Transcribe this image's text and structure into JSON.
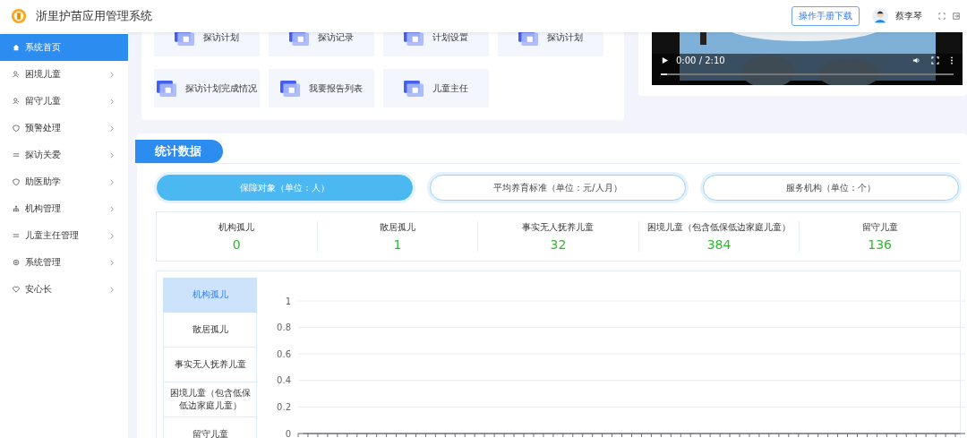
{
  "header": {
    "title": "浙里护苗应用管理系统",
    "manual_button": "操作手册下载",
    "user_name": "蔡李琴"
  },
  "sidebar": {
    "items": [
      {
        "label": "系统首页",
        "selected": true,
        "has_children": false
      },
      {
        "label": "困境儿童",
        "selected": false,
        "has_children": true
      },
      {
        "label": "留守儿童",
        "selected": false,
        "has_children": true
      },
      {
        "label": "预警处理",
        "selected": false,
        "has_children": true
      },
      {
        "label": "探访关爱",
        "selected": false,
        "has_children": true
      },
      {
        "label": "助医助学",
        "selected": false,
        "has_children": true
      },
      {
        "label": "机构管理",
        "selected": false,
        "has_children": true
      },
      {
        "label": "儿童主任管理",
        "selected": false,
        "has_children": true
      },
      {
        "label": "系统管理",
        "selected": false,
        "has_children": true
      },
      {
        "label": "安心长",
        "selected": false,
        "has_children": true
      }
    ]
  },
  "shortcuts": [
    {
      "label": "探访计划"
    },
    {
      "label": "探访记录"
    },
    {
      "label": "计划设置"
    },
    {
      "label": "探访计划"
    },
    {
      "label": "探访计划完成情况"
    },
    {
      "label": "我要报告列表"
    },
    {
      "label": "儿童主任"
    }
  ],
  "video": {
    "time": "0:00 / 2:10",
    "level": 0.02
  },
  "statistics": {
    "title": "统计数据",
    "tabs": [
      {
        "label": "保障对象（单位：人）",
        "selected": true
      },
      {
        "label": "平均养育标准（单位：元/人月）",
        "selected": false
      },
      {
        "label": "服务机构（单位：个）",
        "selected": false
      }
    ],
    "counts": [
      {
        "label": "机构孤儿",
        "value": "0"
      },
      {
        "label": "散居孤儿",
        "value": "1"
      },
      {
        "label": "事实无人抚养儿童",
        "value": "32"
      },
      {
        "label": "困境儿童（包含低保低边家庭儿童）",
        "value": "384"
      },
      {
        "label": "留守儿童",
        "value": "136"
      }
    ],
    "categories": [
      {
        "label": "机构孤儿",
        "selected": true
      },
      {
        "label": "散居孤儿",
        "selected": false
      },
      {
        "label": "事实无人抚养儿童",
        "selected": false
      },
      {
        "label": "困境儿童（包含低保低边家庭儿童）",
        "selected": false
      },
      {
        "label": "留守儿童",
        "selected": false
      }
    ],
    "chart_data": {
      "type": "line",
      "grid": true,
      "ylim": [
        0,
        1
      ],
      "yticks": [
        0,
        0.2,
        0.4,
        0.6,
        0.8,
        1
      ],
      "categories": [
        null,
        null,
        null,
        null,
        null,
        null,
        null,
        null,
        null,
        null,
        null,
        null,
        null,
        null,
        null,
        null,
        null,
        null,
        null,
        null,
        null,
        null,
        null,
        null,
        null,
        null,
        null,
        null,
        null,
        null,
        null,
        null,
        null,
        null,
        null,
        null,
        null,
        null,
        null,
        null,
        null,
        null,
        null,
        null,
        null,
        null,
        null,
        null,
        null,
        null,
        null,
        null,
        null,
        null,
        null,
        null,
        null,
        null,
        null,
        null,
        null,
        null,
        null,
        null,
        null,
        null,
        null,
        null
      ],
      "series": [
        {
          "color": "#6e7079",
          "values": [
            0,
            0,
            0,
            0,
            0,
            0,
            0,
            0,
            0,
            0,
            0,
            0,
            0,
            0,
            0,
            0,
            0,
            0,
            0,
            0,
            0,
            0,
            0,
            0,
            0,
            0,
            0,
            0,
            0,
            0,
            0,
            0,
            0,
            0,
            0,
            0,
            0,
            0,
            0,
            0,
            0,
            0,
            0,
            0,
            0,
            0,
            0,
            0,
            0,
            0,
            0,
            0,
            0,
            0,
            0,
            0,
            0,
            0,
            0,
            0,
            0,
            0,
            0,
            0,
            0,
            0,
            0,
            0
          ]
        }
      ]
    }
  }
}
